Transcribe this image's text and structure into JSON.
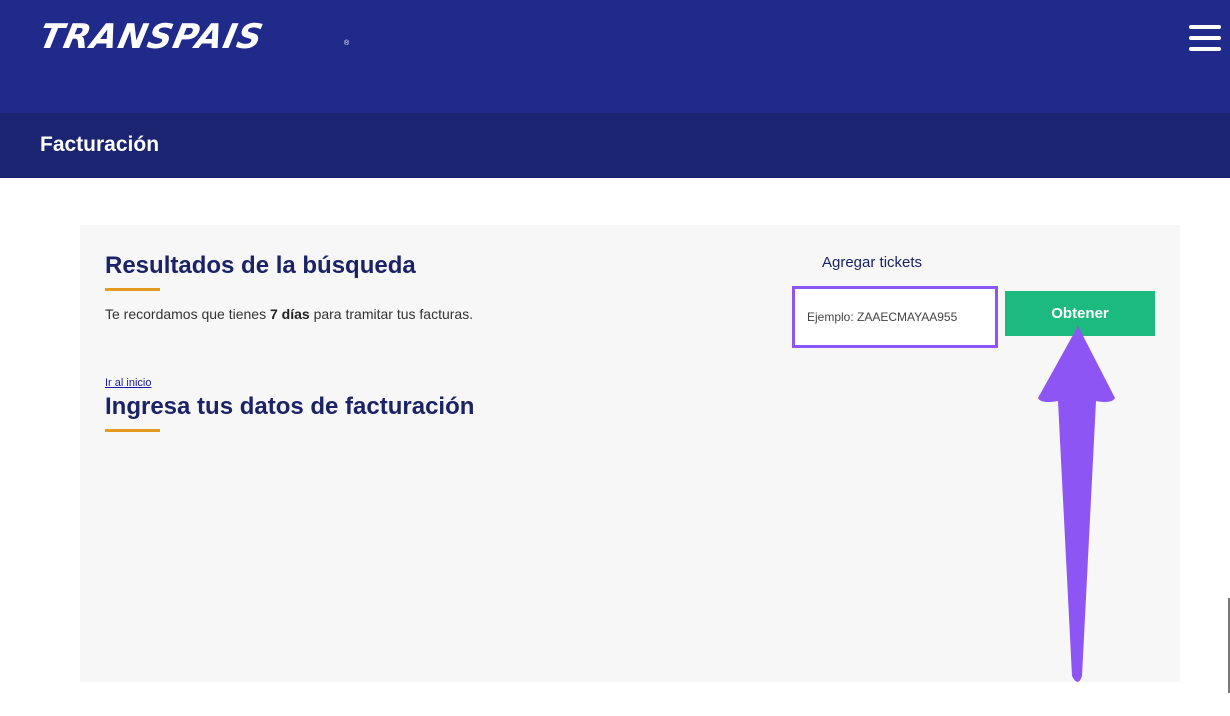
{
  "header": {
    "logo_text": "TRANSPAIS",
    "logo_mark": "®",
    "menu_icon": "hamburger-menu-icon"
  },
  "title_bar": {
    "title": "Facturación"
  },
  "results": {
    "heading": "Resultados de la búsqueda",
    "notice_prefix": "Te recordamos que tienes ",
    "notice_days": "7 días",
    "notice_suffix": " para tramitar tus facturas.",
    "home_link": "Ir al inicio"
  },
  "billing": {
    "heading": "Ingresa tus datos de facturación"
  },
  "tickets": {
    "label": "Agregar tickets",
    "input_placeholder": "Ejemplo: ZAAECMAYAA955",
    "input_value": "",
    "submit_label": "Obtener"
  },
  "colors": {
    "header_bg": "#1f2a8a",
    "title_bar_bg": "#1a2470",
    "accent_underline": "#e39b1f",
    "button_green": "#1cba7e",
    "highlight_purple": "#8e55f5"
  },
  "annotation": {
    "icon": "arrow-up-icon"
  }
}
